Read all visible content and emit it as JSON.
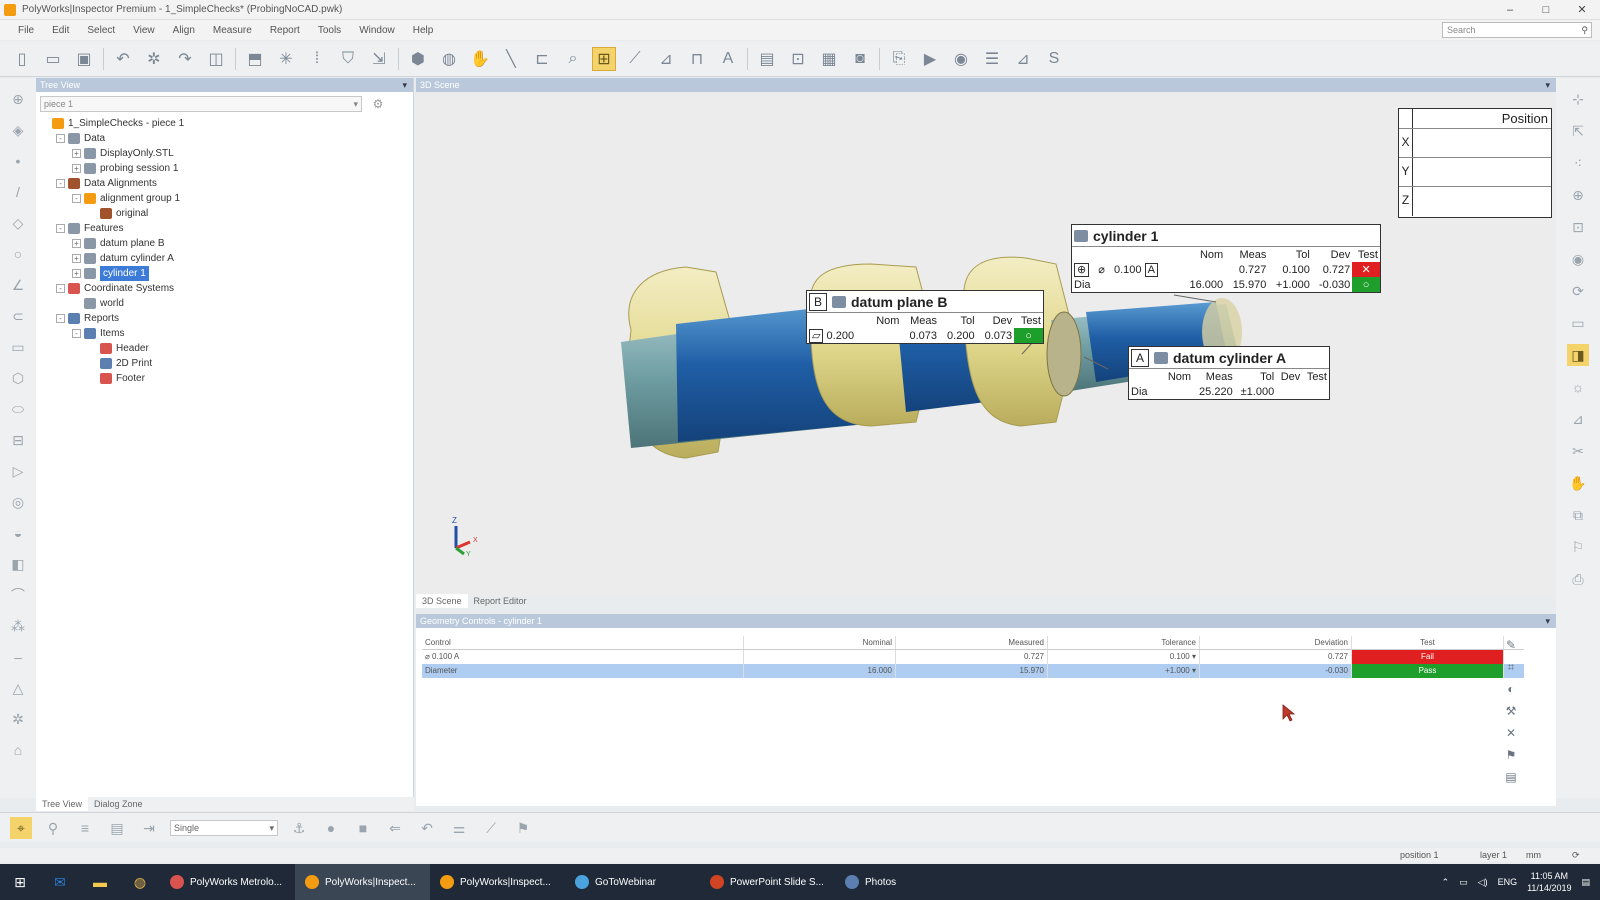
{
  "window": {
    "title": "PolyWorks|Inspector Premium - 1_SimpleChecks* (ProbingNoCAD.pwk)",
    "controls": [
      "–",
      "□",
      "✕"
    ]
  },
  "menu": [
    "File",
    "Edit",
    "Select",
    "View",
    "Align",
    "Measure",
    "Report",
    "Tools",
    "Window",
    "Help"
  ],
  "search": {
    "placeholder": "Search"
  },
  "tree_panel": {
    "header": "Tree View",
    "piece_select": "piece 1",
    "nodes": [
      {
        "label": "1_SimpleChecks - piece 1",
        "depth": 0,
        "exp": "",
        "icon": "orange"
      },
      {
        "label": "Data",
        "depth": 1,
        "exp": "-",
        "icon": "gray"
      },
      {
        "label": "DisplayOnly.STL",
        "depth": 2,
        "exp": "+",
        "icon": "gray"
      },
      {
        "label": "probing session 1",
        "depth": 2,
        "exp": "+",
        "icon": "gray"
      },
      {
        "label": "Data Alignments",
        "depth": 1,
        "exp": "-",
        "icon": "brown"
      },
      {
        "label": "alignment group 1",
        "depth": 2,
        "exp": "-",
        "icon": "orange"
      },
      {
        "label": "original",
        "depth": 3,
        "exp": "",
        "icon": "brown"
      },
      {
        "label": "Features",
        "depth": 1,
        "exp": "-",
        "icon": "gray"
      },
      {
        "label": "datum plane B",
        "depth": 2,
        "exp": "+",
        "icon": "gray"
      },
      {
        "label": "datum cylinder A",
        "depth": 2,
        "exp": "+",
        "icon": "gray"
      },
      {
        "label": "cylinder 1",
        "depth": 2,
        "exp": "+",
        "icon": "gray",
        "selected": true
      },
      {
        "label": "Coordinate Systems",
        "depth": 1,
        "exp": "-",
        "icon": "red"
      },
      {
        "label": "world",
        "depth": 2,
        "exp": "",
        "icon": "gray"
      },
      {
        "label": "Reports",
        "depth": 1,
        "exp": "-",
        "icon": "blue"
      },
      {
        "label": "Items",
        "depth": 2,
        "exp": "-",
        "icon": "blue"
      },
      {
        "label": "Header",
        "depth": 3,
        "exp": "",
        "icon": "red"
      },
      {
        "label": "2D Print",
        "depth": 3,
        "exp": "",
        "icon": "blue"
      },
      {
        "label": "Footer",
        "depth": 3,
        "exp": "",
        "icon": "red"
      }
    ],
    "tabs": [
      "Tree View",
      "Dialog Zone"
    ]
  },
  "scene": {
    "header": "3D Scene",
    "tabs": [
      "3D Scene",
      "Report Editor"
    ],
    "position_table": {
      "title": "Position",
      "rows": [
        "X",
        "Y",
        "Z"
      ]
    },
    "axis_labels": {
      "z": "Z",
      "x": "X",
      "y": "Y"
    },
    "callouts": {
      "cylinder1": {
        "title": "cylinder 1",
        "cols": [
          "Nom",
          "Meas",
          "Tol",
          "Dev",
          "Test"
        ],
        "row1": {
          "sym": "⌀",
          "tol_frame": "0.100",
          "datum": "A",
          "meas": "0.727",
          "tol": "0.100",
          "dev": "0.727",
          "test": "✕"
        },
        "row2": {
          "label": "Dia",
          "nom": "16.000",
          "meas": "15.970",
          "tol": "+1.000",
          "dev": "-0.030",
          "test": "○"
        }
      },
      "datum_plane_b": {
        "letter": "B",
        "title": "datum plane B",
        "cols": [
          "Nom",
          "Meas",
          "Tol",
          "Dev",
          "Test"
        ],
        "row1": {
          "sym": "▱",
          "tol_frame": "0.200",
          "meas": "0.073",
          "tol": "0.200",
          "dev": "0.073",
          "test": "○"
        }
      },
      "datum_cylinder_a": {
        "letter": "A",
        "title": "datum cylinder A",
        "cols": [
          "Nom",
          "Meas",
          "Tol",
          "Dev",
          "Test"
        ],
        "row1": {
          "label": "Dia",
          "meas": "25.220",
          "tol": "±1.000"
        }
      }
    }
  },
  "geometry_controls": {
    "header": "Geometry Controls - cylinder 1",
    "columns": [
      "Control",
      "Nominal",
      "Measured",
      "Tolerance",
      "Deviation",
      "Test"
    ],
    "rows": [
      {
        "control": "⌀ 0.100 A",
        "nominal": "",
        "measured": "0.727",
        "tolerance": "0.100 ▾",
        "deviation": "0.727",
        "test": "Fail",
        "status": "fail"
      },
      {
        "control": "Diameter",
        "nominal": "16.000",
        "measured": "15.970",
        "tolerance": "+1.000 ▾",
        "deviation": "-0.030",
        "test": "Pass",
        "status": "pass"
      }
    ]
  },
  "bottom_toolbar": {
    "mode": "Single"
  },
  "statusbar": {
    "position": "position 1",
    "layer": "layer 1",
    "units": "mm"
  },
  "taskbar": {
    "tasks": [
      {
        "label": "PolyWorks Metrolo...",
        "color": "#d9534f",
        "active": false
      },
      {
        "label": "PolyWorks|Inspect...",
        "color": "#f39c12",
        "active": true
      },
      {
        "label": "PolyWorks|Inspect...",
        "color": "#f39c12",
        "active": false
      },
      {
        "label": "GoToWebinar",
        "color": "#4aa3df",
        "active": false
      },
      {
        "label": "PowerPoint Slide S...",
        "color": "#d04423",
        "active": false
      },
      {
        "label": "Photos",
        "color": "#5a7fb0",
        "active": false
      }
    ],
    "tray": {
      "lang": "ENG",
      "time": "11:05 AM",
      "date": "11/14/2019"
    }
  },
  "colors": {
    "fail": "#e02020",
    "pass": "#1e9e2a",
    "selection": "#3d7bd9",
    "panel_header": "#b9c9db"
  }
}
